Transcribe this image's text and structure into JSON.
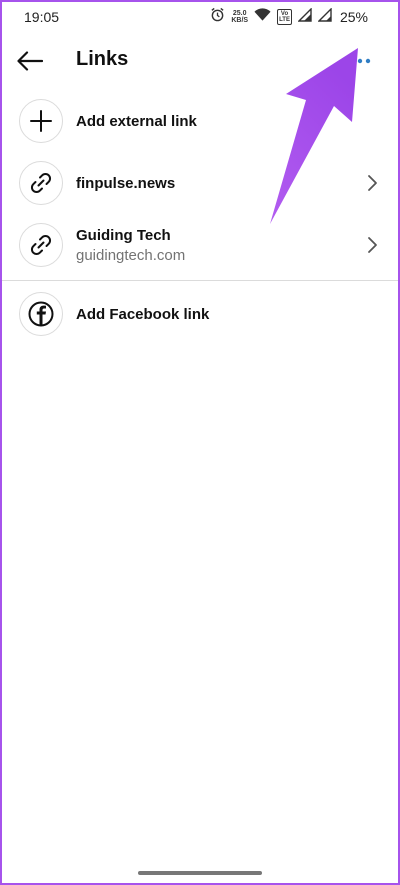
{
  "status_bar": {
    "time": "19:05",
    "speed_value": "25.0",
    "speed_unit": "KB/S",
    "volte_top": "Vo",
    "volte_bottom": "LTE",
    "battery": "25%"
  },
  "header": {
    "title": "Links"
  },
  "links": [
    {
      "id": "add-external",
      "icon": "plus-icon",
      "primary": "Add external link",
      "secondary": "",
      "has_chevron": false
    },
    {
      "id": "finpulse",
      "icon": "link-icon",
      "primary": "finpulse.news",
      "secondary": "",
      "has_chevron": true
    },
    {
      "id": "guiding-tech",
      "icon": "link-icon",
      "primary": "Guiding Tech",
      "secondary": "guidingtech.com",
      "has_chevron": true
    },
    {
      "id": "add-facebook",
      "icon": "facebook-icon",
      "primary": "Add Facebook link",
      "secondary": "",
      "has_chevron": false
    }
  ],
  "colors": {
    "accent_blue": "#2f7ec4",
    "annotation_purple": "#a653ec",
    "divider": "#dbdbdb",
    "secondary_text": "#737373"
  }
}
